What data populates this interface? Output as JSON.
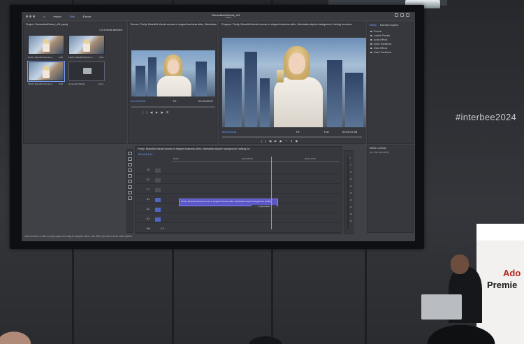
{
  "venue": {
    "event_tag": "#interbee2024",
    "banner_top": "Ado",
    "banner_main": "Premie"
  },
  "menubar": {
    "items": [
      "Import",
      "Edit",
      "Export"
    ],
    "active_index": 1,
    "doc_title": "GenerativeExtend_v01",
    "doc_subtitle": "· Edited"
  },
  "project": {
    "title": "Project: GenerativeExtend_v01.prproj",
    "selection_info": "1 of 6 items selected",
    "items": [
      {
        "label": "Firefly: Beautiful blonde w...",
        "duration": "0:08"
      },
      {
        "label": "Firefly: Beautiful blonde w...",
        "duration": "0:08"
      },
      {
        "label": "Firefly: Beautiful blonde w...",
        "duration": "0:08"
      },
      {
        "label": "Generated Media",
        "duration": "1 item"
      }
    ]
  },
  "source": {
    "title": "Source: Firefly: Beautiful blonde woman in elegant business attire, Manhattan",
    "timecode_in": "00:00:00:00",
    "fit": "Fit",
    "timecode_out": "00:00:08:07"
  },
  "program": {
    "title": "Program: Firefly: Beautiful blonde woman in elegant business attire, Manhattan skyline background, holding luxurious",
    "timecode": "00:00:04:11",
    "fit": "Fit",
    "duration": "00:00:07:08",
    "quality": "Full"
  },
  "effects": {
    "tabs": [
      "Effects",
      "Essential Graphics"
    ],
    "items": [
      "Presets",
      "Lumetri Presets",
      "Audio Effects",
      "Audio Transitions",
      "Video Effects",
      "Video Transitions"
    ],
    "controls_title": "Effect Controls",
    "no_clip": "(no clip selected)"
  },
  "timeline": {
    "sequence": "Firefly: Beautiful blonde woman in elegant business attire, Manhattan skyline background, holding lux",
    "timecode": "00:00:04:11",
    "ruler_ticks": [
      "00:00",
      "00:00:05:00",
      "00:00:10:00"
    ],
    "tracks": [
      "V3",
      "V2",
      "V1",
      "A1",
      "A2",
      "A3",
      "Mix"
    ],
    "clip_label": "Firefly: Beautiful blonde woman in elegant business attire, Manhattan skyline background, holding",
    "extend_tag": "AI-generated",
    "mix_value": "0.0"
  },
  "status_bar": "Click to select, or click in empty space and drag to marquee select. Use Shift, Opt, and Cmd for other options.",
  "meter_scale": [
    "0",
    "-6",
    "-12",
    "-18",
    "-24",
    "-30",
    "-36",
    "-42",
    "-48",
    "-54"
  ]
}
